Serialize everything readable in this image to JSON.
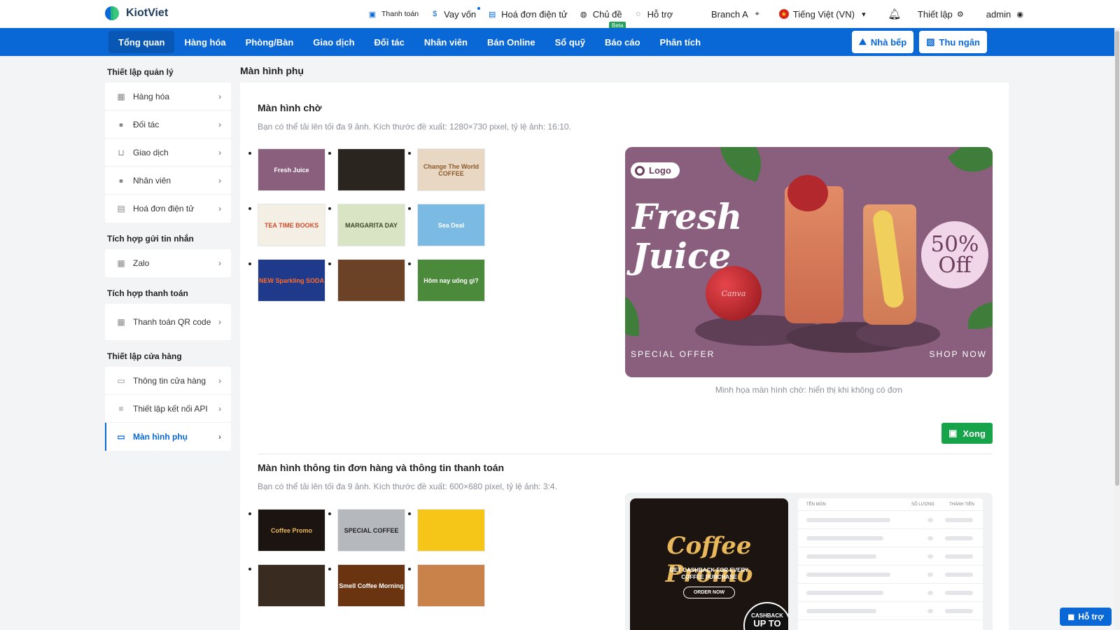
{
  "brand": {
    "name": "KiotViet"
  },
  "topnav": {
    "items": [
      {
        "label": "Thanh toán",
        "icon": "payment-icon"
      },
      {
        "label": "Vay vốn",
        "icon": "money-bag-icon"
      },
      {
        "label": "Hoá đơn điện tử",
        "icon": "invoice-icon"
      },
      {
        "label": "Chủ đề",
        "icon": "palette-icon",
        "badge": "Beta"
      },
      {
        "label": "Hỗ trợ",
        "icon": "chat-icon"
      }
    ],
    "branch": "Branch A",
    "language": "Tiếng Việt (VN)",
    "settings": "Thiết lập",
    "user": "admin"
  },
  "mainnav": {
    "tabs": [
      "Tổng quan",
      "Hàng hóa",
      "Phòng/Bàn",
      "Giao dịch",
      "Đối tác",
      "Nhân viên",
      "Bán Online",
      "Sổ quỹ",
      "Báo cáo",
      "Phân tích"
    ],
    "active": "Tổng quan",
    "kitchen": "Nhà bếp",
    "cashier": "Thu ngân"
  },
  "sidebar": {
    "sections": [
      {
        "title": "Thiết lập quản lý",
        "items": [
          "Hàng hóa",
          "Đối tác",
          "Giao dịch",
          "Nhân viên",
          "Hoá đơn điện tử"
        ]
      },
      {
        "title": "Tích hợp gửi tin nhắn",
        "items": [
          "Zalo"
        ]
      },
      {
        "title": "Tích hợp thanh toán",
        "items": [
          "Thanh toán QR code"
        ]
      },
      {
        "title": "Thiết lập cửa hàng",
        "items": [
          "Thông tin cửa hàng",
          "Thiết lập kết nối API",
          "Màn hình phụ"
        ]
      }
    ],
    "active": "Màn hình phụ"
  },
  "page": {
    "title": "Màn hình phụ"
  },
  "standby": {
    "title": "Màn hình chờ",
    "desc": "Bạn có thể tải lên tối đa 9 ảnh. Kích thước đề xuất: 1280×730 pixel, tỷ lệ ảnh: 16:10.",
    "thumbs": [
      {
        "text": "Fresh Juice",
        "bg": "#8a5f7d",
        "fg": "#ffffff"
      },
      {
        "text": "",
        "bg": "#2b2520",
        "fg": "#ffffff"
      },
      {
        "text": "Change The World COFFEE",
        "bg": "#e8d8c3",
        "fg": "#8b5a2b"
      },
      {
        "text": "TEA TIME BOOKS",
        "bg": "#f4efe4",
        "fg": "#d14b2a"
      },
      {
        "text": "MARGARITA DAY",
        "bg": "#d8e4c4",
        "fg": "#3b4a2a"
      },
      {
        "text": "Sea Deal",
        "bg": "#7bbbe3",
        "fg": "#ffffff"
      },
      {
        "text": "NEW Sparkling SODA",
        "bg": "#1f3a8a",
        "fg": "#ff6b2b"
      },
      {
        "text": "",
        "bg": "#6b4226",
        "fg": "#ffffff"
      },
      {
        "text": "Hôm nay uống gì?",
        "bg": "#4a8a3a",
        "fg": "#ffffff"
      }
    ],
    "preview": {
      "logo": "Logo",
      "title_line1": "Fresh",
      "title_line2": "Juice",
      "badge_line1": "50%",
      "badge_line2": "Off",
      "footer_left": "SPECIAL OFFER",
      "footer_right": "SHOP NOW",
      "apple_label": "Canva"
    },
    "caption": "Minh họa màn hình chờ: hiển thị khi không có đơn",
    "done": "Xong"
  },
  "order": {
    "title": "Màn hình thông tin đơn hàng và thông tin thanh toán",
    "desc": "Bạn có thể tải lên tối đa 9 ảnh. Kích thước đề xuất: 600×680 pixel, tỷ lệ ảnh: 3:4.",
    "thumbs": [
      {
        "text": "Coffee Promo",
        "bg": "#1c1410",
        "fg": "#e8b85b"
      },
      {
        "text": "SPECIAL COFFEE",
        "bg": "#b5b8bd",
        "fg": "#222222"
      },
      {
        "text": "",
        "bg": "#f5c518",
        "fg": "#111111"
      },
      {
        "text": "",
        "bg": "#3a2b20",
        "fg": "#ffffff"
      },
      {
        "text": "Smell Coffee Morning",
        "bg": "#6b3410",
        "fg": "#ffffff"
      },
      {
        "text": "",
        "bg": "#c8824a",
        "fg": "#ffffff"
      }
    ],
    "promo": {
      "title": "Coffee Promo",
      "sub_line1": "GET CASHBACK FOR EVERY",
      "sub_line2": "COFFEE PURCHASE",
      "order_now": "ORDER NOW",
      "cashback_line1": "CASHBACK",
      "cashback_line2": "UP TO"
    },
    "table_headers": [
      "TÊN MÓN",
      "SỐ LƯỢNG",
      "THÀNH TIỀN"
    ]
  },
  "help": {
    "label": "Hỗ trợ"
  },
  "colors": {
    "primary": "#0a68d6",
    "success": "#16a34a"
  }
}
